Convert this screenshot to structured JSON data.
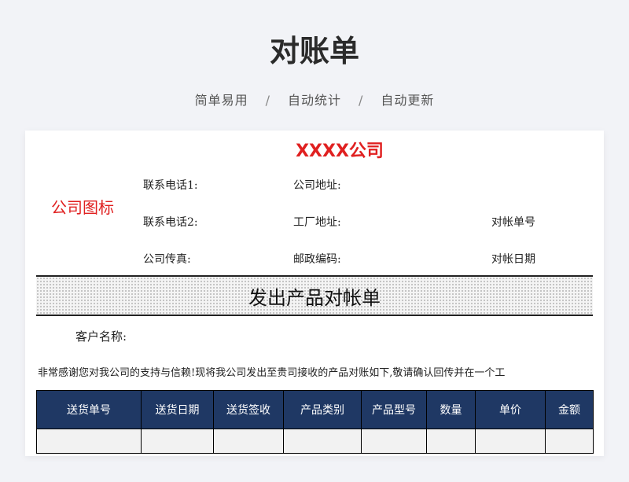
{
  "header": {
    "title": "对账单",
    "tagline": [
      "简单易用",
      "自动统计",
      "自动更新"
    ],
    "separator": "/"
  },
  "sheet": {
    "company_name": "XXXX公司",
    "logo_placeholder": "公司图标",
    "info": {
      "phone1": "联系电话1:",
      "phone2": "联系电话2:",
      "fax": "公司传真:",
      "address": "公司地址:",
      "factory_address": "工厂地址:",
      "postal_code": "邮政编码:",
      "statement_no": "对帐单号",
      "statement_date": "对帐日期"
    },
    "banner_title": "发出产品对帐单",
    "customer_label": "客户名称:",
    "notice": "非常感谢您对我公司的支持与信赖!现将我公司发出至贵司接收的产品对账如下,敬请确认回传并在一个工",
    "table": {
      "columns": [
        "送货单号",
        "送货日期",
        "送货签收",
        "产品类别",
        "产品型号",
        "数量",
        "单价",
        "金额"
      ]
    }
  }
}
